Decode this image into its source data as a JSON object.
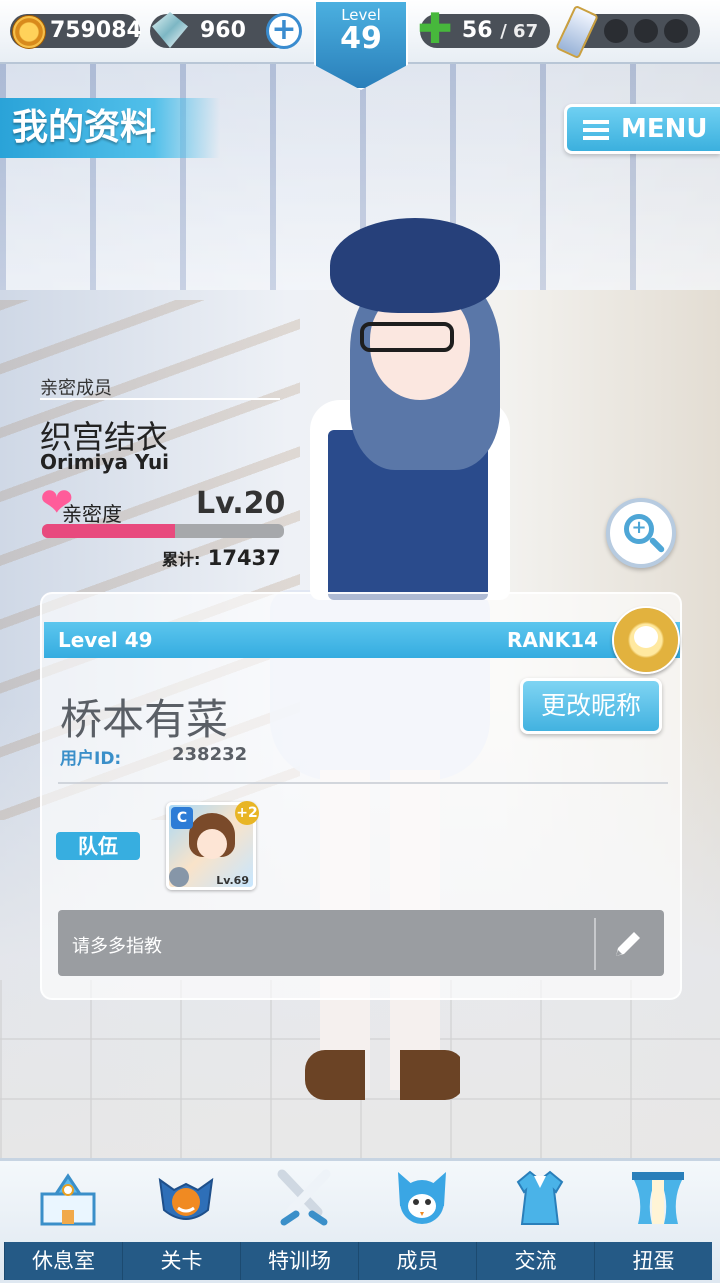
{
  "header": {
    "coins": "759084",
    "gems": "960",
    "gems_plus": "+",
    "level_label": "Level",
    "level_value": "49",
    "stamina_current": "56",
    "stamina_max": "/ 67"
  },
  "page": {
    "title": "我的资料",
    "menu_label": "MENU"
  },
  "intimate_member": {
    "section_label": "亲密成员",
    "name": "织宫结衣",
    "name_romaji": "Orimiya Yui",
    "affection_label": "亲密度",
    "affection_level": "Lv.20",
    "affection_progress": 0.55,
    "total_label": "累计:",
    "total_value": "17437"
  },
  "profile": {
    "level_text": "Level 49",
    "rank_text": "RANK14",
    "nickname": "桥本有菜",
    "rename_button": "更改昵称",
    "user_id_label": "用户ID:",
    "user_id_value": "238232",
    "team_label": "队伍",
    "team_card": {
      "attribute": "C",
      "bonus": "+2",
      "level": "Lv.69"
    },
    "message": "请多多指教"
  },
  "bottom_nav": [
    {
      "label": "休息室",
      "icon": "school-building-icon"
    },
    {
      "label": "关卡",
      "icon": "demon-mask-icon"
    },
    {
      "label": "特训场",
      "icon": "crossed-swords-icon"
    },
    {
      "label": "成员",
      "icon": "cat-mascot-icon"
    },
    {
      "label": "交流",
      "icon": "uniform-dress-icon"
    },
    {
      "label": "扭蛋",
      "icon": "curtain-stage-icon"
    }
  ],
  "colors": {
    "accent": "#35ace0",
    "nav_bar": "#255a86",
    "affection_fill": "#e84a7e"
  }
}
